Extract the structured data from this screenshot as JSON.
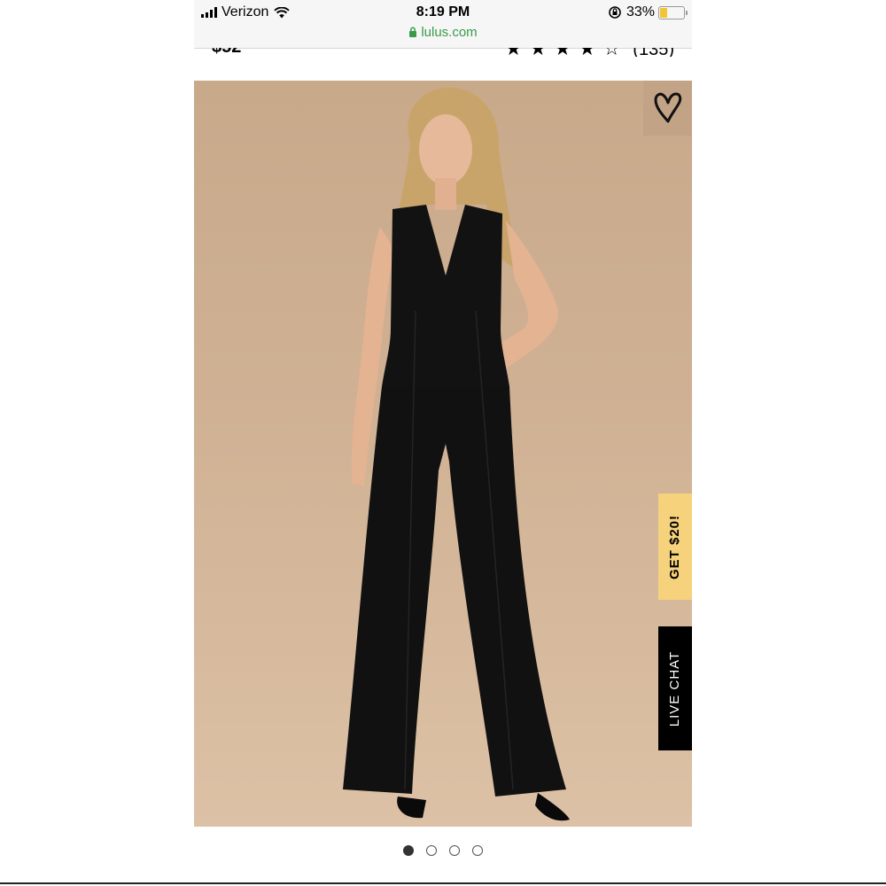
{
  "status_bar": {
    "carrier": "Verizon",
    "time": "8:19 PM",
    "battery": "33%",
    "battery_level": 0.33,
    "url": "lulus.com"
  },
  "product": {
    "price": "$52",
    "rating": 4,
    "review_count": "(135)"
  },
  "image": {
    "alt": "Model wearing black sleeveless V-neck wide-leg jumpsuit",
    "colors": {
      "background": "#d0b194",
      "garment": "#111111",
      "promo": "#f7d27d"
    }
  },
  "tabs": {
    "promo": "GET $20!",
    "chat": "LIVE CHAT"
  },
  "carousel": {
    "total": 4,
    "active": 1
  },
  "icons": {
    "wishlist": "heart-icon",
    "lock": "lock-icon",
    "wifi": "wifi-icon",
    "signal": "signal-icon",
    "orientation": "rotation-lock-icon"
  }
}
